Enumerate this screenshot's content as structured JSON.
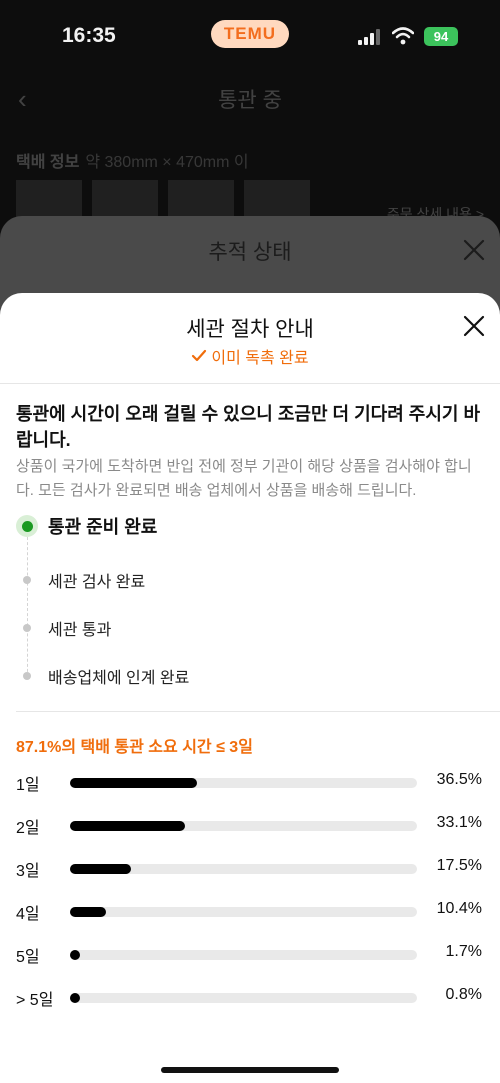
{
  "status_bar": {
    "time": "16:35",
    "app_badge": "TEMU",
    "battery": "94"
  },
  "background_page": {
    "title": "통관 중",
    "info_label": "택배 정보",
    "info_size": "약 380mm × 470mm 이",
    "link": "주문 상세 내용 >"
  },
  "tracking_sheet": {
    "title": "추적 상태"
  },
  "modal": {
    "title": "세관 절차 안내",
    "status": "이미 독촉 완료",
    "headline": "통관에 시간이 오래 걸릴 수 있으니 조금만 더 기다려 주시기 바랍니다.",
    "description": "상품이 국가에 도착하면 반입 전에 정부 기관이 해당 상품을 검사해야 합니다. 모든 검사가 완료되면 배송 업체에서 상품을 배송해 드립니다.",
    "steps": [
      {
        "label": "통관 준비 완료",
        "active": true
      },
      {
        "label": "세관 검사 완료",
        "active": false
      },
      {
        "label": "세관 통과",
        "active": false
      },
      {
        "label": "배송업체에 인계 완료",
        "active": false
      }
    ],
    "stats_title": "87.1%의 택배 통관 소요 시간 ≤ 3일"
  },
  "chart_data": {
    "type": "bar",
    "orientation": "horizontal",
    "categories": [
      "1일",
      "2일",
      "3일",
      "4일",
      "5일",
      "> 5일"
    ],
    "values": [
      36.5,
      33.1,
      17.5,
      10.4,
      1.7,
      0.8
    ],
    "value_labels": [
      "36.5%",
      "33.1%",
      "17.5%",
      "10.4%",
      "1.7%",
      "0.8%"
    ],
    "unit": "%",
    "xlim": [
      0,
      100
    ],
    "bar_color": "#000000",
    "track_color": "#e9e9e9"
  },
  "colors": {
    "accent": "#f06d0c",
    "active_step": "#1b9a22"
  }
}
